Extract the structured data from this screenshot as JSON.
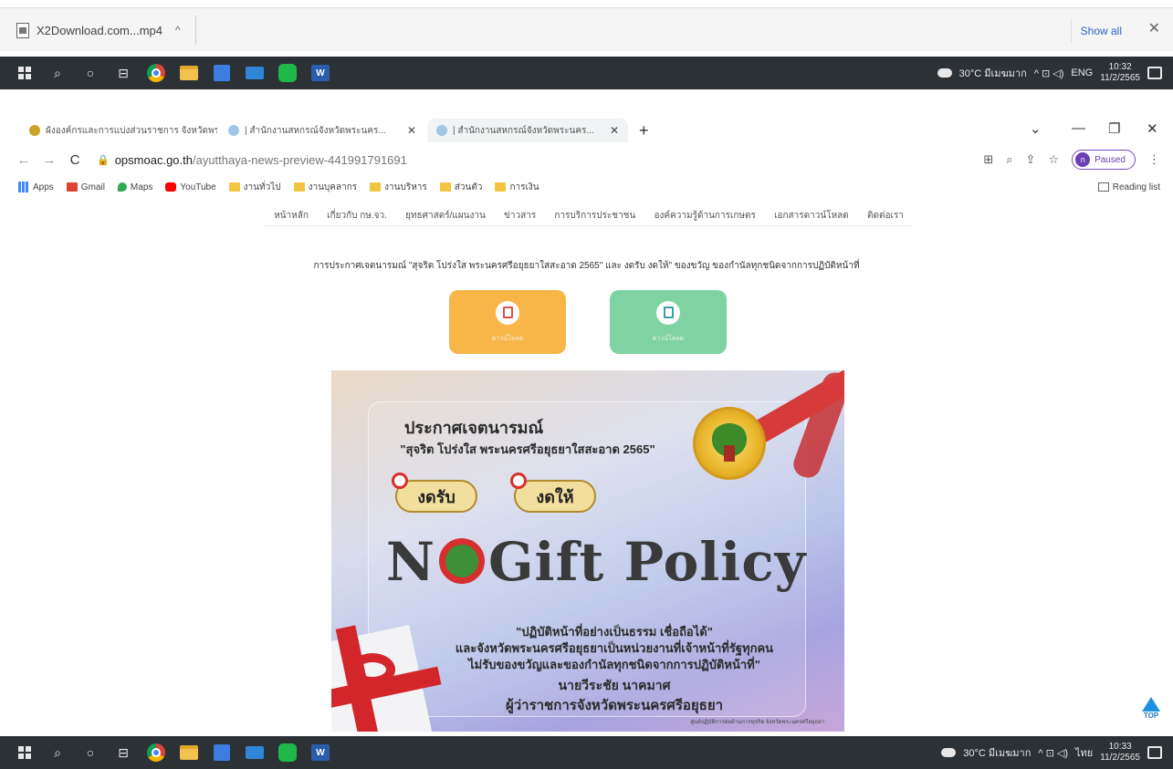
{
  "download_bar": {
    "filename": "X2Download.com...mp4",
    "chevron": "^",
    "show_all": "Show all",
    "close": "✕"
  },
  "taskbar_top": {
    "weather": "30°C มีเมฆมาก",
    "tray": "^ ⊡ ◁)",
    "language": "ENG",
    "time": "10:32",
    "date": "11/2/2565"
  },
  "taskbar_bottom": {
    "weather": "30°C มีเมฆมาก",
    "tray": "^ ⊡ ◁)",
    "language": "ไทย",
    "time": "10:33",
    "date": "11/2/2565"
  },
  "browser": {
    "tabs": [
      {
        "label": "ผังองค์กรและการแบ่งส่วนราชการ จังหวัดพระนคร...",
        "close": "✕"
      },
      {
        "label": "| สำนักงานสหกรณ์จังหวัดพระนคร...",
        "close": "✕"
      },
      {
        "label": "| สำนักงานสหกรณ์จังหวัดพระนคร...",
        "close": "✕"
      }
    ],
    "new_tab": "+",
    "window_controls": [
      "⌄",
      "—",
      "❐",
      "✕"
    ],
    "nav": {
      "back": "←",
      "forward": "→",
      "reload": "C"
    },
    "url_host": "opsmoac.go.th",
    "url_path": "/ayutthaya-news-preview-441991791691",
    "profile_initial": "ก",
    "profile_status": "Paused",
    "menu_dots": "⋮",
    "bookmarks": [
      "Apps",
      "Gmail",
      "Maps",
      "YouTube",
      "งานทั่วไป",
      "งานบุคลากร",
      "งานบริหาร",
      "ส่วนตัว",
      "การเงิน"
    ],
    "reading_list": "Reading list"
  },
  "page": {
    "menu": [
      "หน้าหลัก",
      "เกี่ยวกับ กษ.จว.",
      "ยุทธศาสตร์/แผนงาน",
      "ข่าวสาร",
      "การบริการประชาชน",
      "องค์ความรู้ด้านการเกษตร",
      "เอกสารดาวน์โหลด",
      "ติดต่อเรา"
    ],
    "headline": "การประกาศเจตนารมณ์ \"สุจริต โปร่งใส พระนครศรีอยุธยาใสสะอาด 2565\" และ งดรับ งดให้\" ของขวัญ ของกำนัลทุกชนิดจากการปฏิบัติหน้าที่",
    "download_pdf_label": "ดาวน์โหลด",
    "download_doc_label": "ดาวน์โหลด"
  },
  "poster": {
    "title": "ประกาศเจตนารมณ์",
    "subtitle": "\"สุจริต โปร่งใส พระนครศรีอยุธยาใสสะอาด 2565\"",
    "pill_a": "งดรับ",
    "pill_b": "งดให้",
    "gift_n": "N",
    "gift_rest": "Gift Policy",
    "quote_1": "\"ปฏิบัติหน้าที่อย่างเป็นธรรม เชื่อถือได้\"",
    "quote_2": "และจังหวัดพระนครศรีอยุธยาเป็นหน่วยงานที่เจ้าหน้าที่รัฐทุกคน",
    "quote_3": "ไม่รับของขวัญและของกำนัลทุกชนิดจากการปฏิบัติหน้าที่\"",
    "name": "นายวีระชัย นาคมาศ",
    "role": "ผู้ว่าราชการจังหวัดพระนครศรีอยุธยา",
    "footer": "ศูนย์ปฏิบัติการต่อต้านการทุจริต จังหวัดพระนครศรีอยุธยา"
  },
  "to_top": "TOP"
}
